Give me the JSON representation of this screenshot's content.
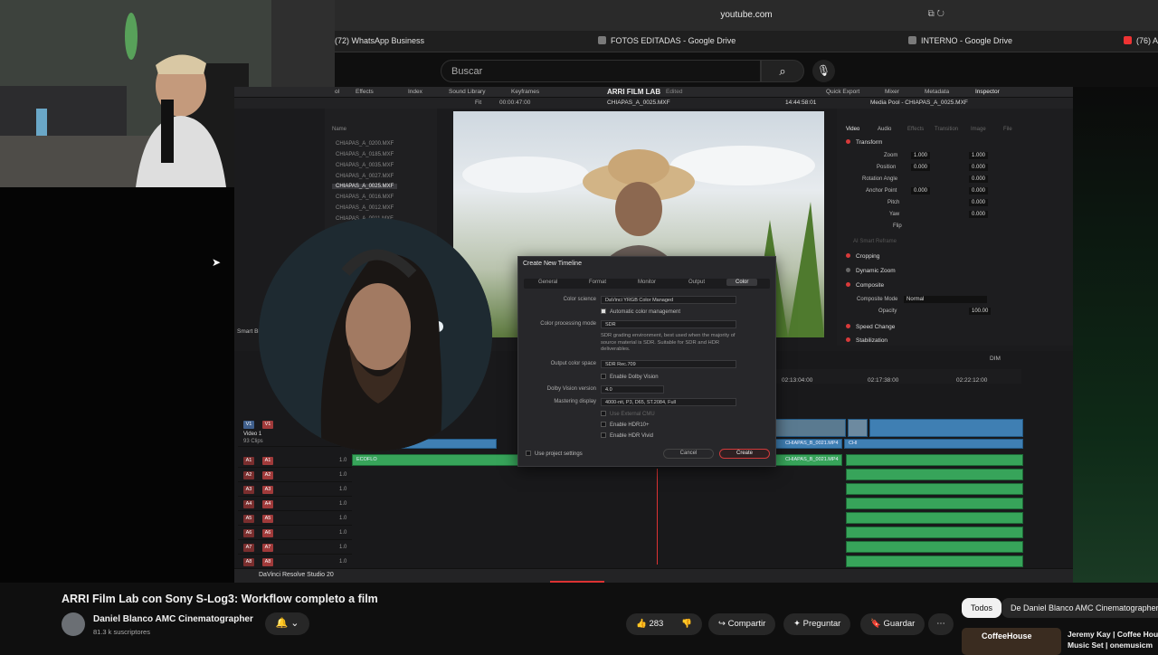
{
  "browser": {
    "url": "youtube.com",
    "tabs": [
      "(72) WhatsApp Business",
      "FOTOS EDITADAS - Google Drive",
      "INTERNO - Google Drive",
      "(76) A"
    ]
  },
  "yt_header": {
    "search_placeholder": "Buscar"
  },
  "resolve": {
    "toolbar_items": [
      "ol",
      "Effects",
      "Index",
      "Sound Library",
      "Keyframes",
      "Quick Export",
      "Mixer",
      "Metadata",
      "Inspector"
    ],
    "project_title": "ARRI FILM LAB",
    "project_status": "Edited",
    "viewer_fit": "Fit",
    "viewer_tc_in": "00:00:47:00",
    "viewer_clip": "CHIAPAS_A_0025.MXF",
    "viewer_tc_out": "14:44:58:01",
    "media_pool_title": "Media Pool - CHIAPAS_A_0025.MXF",
    "name_col": "Name",
    "clips": [
      "CHIAPAS_A_0200.MXF",
      "CHIAPAS_A_0185.MXF",
      "CHIAPAS_A_0035.MXF",
      "CHIAPAS_A_0027.MXF",
      "CHIAPAS_A_0025.MXF",
      "CHIAPAS_A_0016.MXF",
      "CHIAPAS_A_0012.MXF",
      "CHIAPAS_A_0011.MXF"
    ],
    "smart_bins": "Smart Bi",
    "inspector_tabs": [
      "Video",
      "Audio",
      "Effects",
      "Transition",
      "Image",
      "File"
    ],
    "inspector": {
      "transform": "Transform",
      "zoom_label": "Zoom",
      "zoom_x": "1.000",
      "zoom_y": "1.000",
      "position_label": "Position",
      "pos_x": "0.000",
      "pos_y": "0.000",
      "rotation_label": "Rotation Angle",
      "rotation": "0.000",
      "anchor_label": "Anchor Point",
      "anchor_x": "0.000",
      "anchor_y": "0.000",
      "pitch_label": "Pitch",
      "pitch": "0.000",
      "yaw_label": "Yaw",
      "yaw": "0.000",
      "flip_label": "Flip",
      "smart_reframe": "AI Smart Reframe",
      "cropping": "Cropping",
      "dynamic_zoom": "Dynamic Zoom",
      "composite": "Composite",
      "composite_mode_label": "Composite Mode",
      "composite_mode": "Normal",
      "opacity_label": "Opacity",
      "opacity": "100.00",
      "speed_change": "Speed Change",
      "stabilization": "Stabilization"
    },
    "ruler_marks": [
      "02:13:04:00",
      "02:17:38:00",
      "02:22:12:00"
    ],
    "video_track": {
      "id": "V1",
      "name": "Video 1",
      "clips": "93 Clips"
    },
    "audio_tracks": [
      "A1",
      "A2",
      "A3",
      "A4",
      "A5",
      "A6",
      "A7",
      "A8"
    ],
    "audio_level": "1.0",
    "timeline_clip_labels": [
      "CHIAPAS_B_0021.MP4",
      "CHIAPAS_B_0021.MP4",
      "ECOFLO",
      "EC",
      "CHI"
    ],
    "app_brand": "DaVinci Resolve Studio 20",
    "dim_label": "DIM"
  },
  "dialog": {
    "title": "Create New Timeline",
    "tabs": [
      "General",
      "Format",
      "Monitor",
      "Output",
      "Color"
    ],
    "selected_tab": "Color",
    "color_science_label": "Color science",
    "color_science": "DaVinci YRGB Color Managed",
    "auto_cm": "Automatic color management",
    "processing_label": "Color processing mode",
    "processing": "SDR",
    "processing_note": "SDR grading environment, best used when the majority of source material is SDR. Suitable for SDR and HDR deliverables.",
    "output_cs_label": "Output color space",
    "output_cs": "SDR Rec.709",
    "enable_dolby": "Enable Dolby Vision",
    "dolby_version_label": "Dolby Vision version",
    "dolby_version": "4.0",
    "mastering_label": "Mastering display",
    "mastering": "4000-nit, P3, D65, ST.2084, Full",
    "use_external_cmu": "Use External CMU",
    "enable_hdr10": "Enable HDR10+",
    "enable_hdr_vivid": "Enable HDR Vivid",
    "use_project_settings": "Use project settings",
    "cancel": "Cancel",
    "create": "Create"
  },
  "yt_video": {
    "title": "ARRI Film Lab con Sony S-Log3: Workflow completo a film",
    "channel": "Daniel Blanco AMC Cinematographer",
    "subscribers": "81.3 k suscriptores",
    "likes": "283",
    "share": "Compartir",
    "ask": "Preguntar",
    "save": "Guardar",
    "filter_all": "Todos",
    "filter_channel": "De Daniel Blanco AMC Cinematographer",
    "rec_title_1": "Jeremy Kay | Coffee Hou",
    "rec_title_2": "Music Set | onemusicm",
    "rec_thumb_text": "CoffeeHouse"
  },
  "colors": {
    "accent_red": "#d83a3a",
    "yt_bg": "#0f0f0f",
    "clip_green": "#37a45a",
    "clip_blue": "#3f7fb3"
  }
}
